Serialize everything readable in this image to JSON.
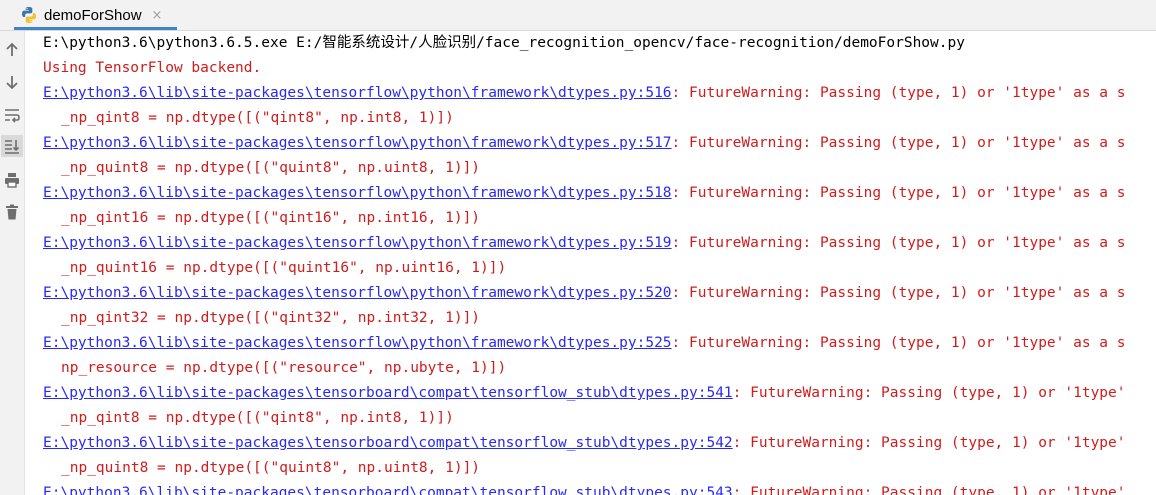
{
  "tab": {
    "title": "demoForShow",
    "close": "×"
  },
  "sidebar": {
    "tools": [
      "arrow-up-icon",
      "arrow-down-icon",
      "soft-wrap-icon",
      "scroll-to-end-icon",
      "print-icon",
      "trash-icon"
    ]
  },
  "colors": {
    "link": "#2a2aef",
    "error": "#d01c1c",
    "text": "#000000"
  },
  "console": {
    "command": "E:\\python3.6\\python3.6.5.exe E:/智能系统设计/人脸识别/face_recognition_opencv/face-recognition/demoForShow.py",
    "tf_backend": "Using TensorFlow backend.",
    "warn_suffix": ": FutureWarning: Passing (type, 1) or '1type' as a s",
    "warn_suffix_short": ": FutureWarning: Passing (type, 1) or '1type'",
    "w1_link": "E:\\python3.6\\lib\\site-packages\\tensorflow\\python\\framework\\dtypes.py:516",
    "w1_code": "_np_qint8 = np.dtype([(\"qint8\", np.int8, 1)])",
    "w2_link": "E:\\python3.6\\lib\\site-packages\\tensorflow\\python\\framework\\dtypes.py:517",
    "w2_code": "_np_quint8 = np.dtype([(\"quint8\", np.uint8, 1)])",
    "w3_link": "E:\\python3.6\\lib\\site-packages\\tensorflow\\python\\framework\\dtypes.py:518",
    "w3_code": "_np_qint16 = np.dtype([(\"qint16\", np.int16, 1)])",
    "w4_link": "E:\\python3.6\\lib\\site-packages\\tensorflow\\python\\framework\\dtypes.py:519",
    "w4_code": "_np_quint16 = np.dtype([(\"quint16\", np.uint16, 1)])",
    "w5_link": "E:\\python3.6\\lib\\site-packages\\tensorflow\\python\\framework\\dtypes.py:520",
    "w5_code": "_np_qint32 = np.dtype([(\"qint32\", np.int32, 1)])",
    "w6_link": "E:\\python3.6\\lib\\site-packages\\tensorflow\\python\\framework\\dtypes.py:525",
    "w6_code": "np_resource = np.dtype([(\"resource\", np.ubyte, 1)])",
    "w7_link": "E:\\python3.6\\lib\\site-packages\\tensorboard\\compat\\tensorflow_stub\\dtypes.py:541",
    "w7_code": "_np_qint8 = np.dtype([(\"qint8\", np.int8, 1)])",
    "w8_link": "E:\\python3.6\\lib\\site-packages\\tensorboard\\compat\\tensorflow_stub\\dtypes.py:542",
    "w8_code": "_np_quint8 = np.dtype([(\"quint8\", np.uint8, 1)])",
    "w9_link": "E:\\python3.6\\lib\\site-packages\\tensorboard\\compat\\tensorflow_stub\\dtypes.py:543"
  }
}
